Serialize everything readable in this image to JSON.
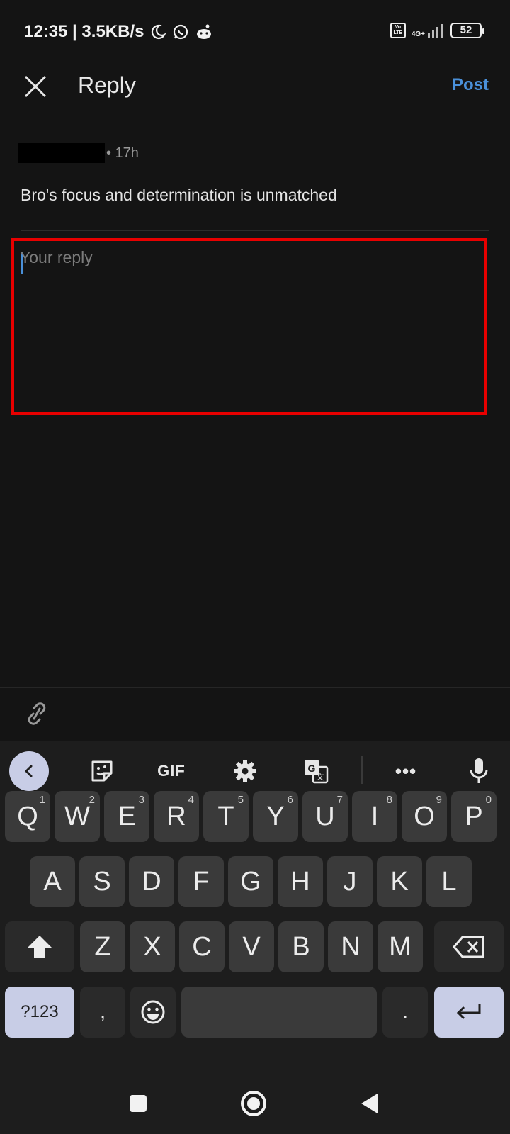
{
  "status_bar": {
    "time_speed": "12:35 | 3.5KB/s",
    "volte_top": "Vo",
    "volte_bottom": "LTE",
    "network": "4G+",
    "battery": "52"
  },
  "header": {
    "title": "Reply",
    "post_label": "Post"
  },
  "parent_comment": {
    "time": "• 17h",
    "body": "Bro's focus and determination is unmatched"
  },
  "reply": {
    "placeholder": "Your reply",
    "value": ""
  },
  "keyboard": {
    "toolbar": {
      "gif_label": "GIF",
      "more_label": "•••"
    },
    "row1": [
      {
        "label": "Q",
        "hint": "1"
      },
      {
        "label": "W",
        "hint": "2"
      },
      {
        "label": "E",
        "hint": "3"
      },
      {
        "label": "R",
        "hint": "4"
      },
      {
        "label": "T",
        "hint": "5"
      },
      {
        "label": "Y",
        "hint": "6"
      },
      {
        "label": "U",
        "hint": "7"
      },
      {
        "label": "I",
        "hint": "8"
      },
      {
        "label": "O",
        "hint": "9"
      },
      {
        "label": "P",
        "hint": "0"
      }
    ],
    "row2": [
      "A",
      "S",
      "D",
      "F",
      "G",
      "H",
      "J",
      "K",
      "L"
    ],
    "row3": [
      "Z",
      "X",
      "C",
      "V",
      "B",
      "N",
      "M"
    ],
    "symbols_label": "?123",
    "comma_label": ",",
    "period_label": "."
  },
  "colors": {
    "accent": "#4a90d9",
    "highlight_border": "#e80000",
    "background": "#141414",
    "key": "#3a3a3a",
    "key_accent": "#c8cde6"
  }
}
